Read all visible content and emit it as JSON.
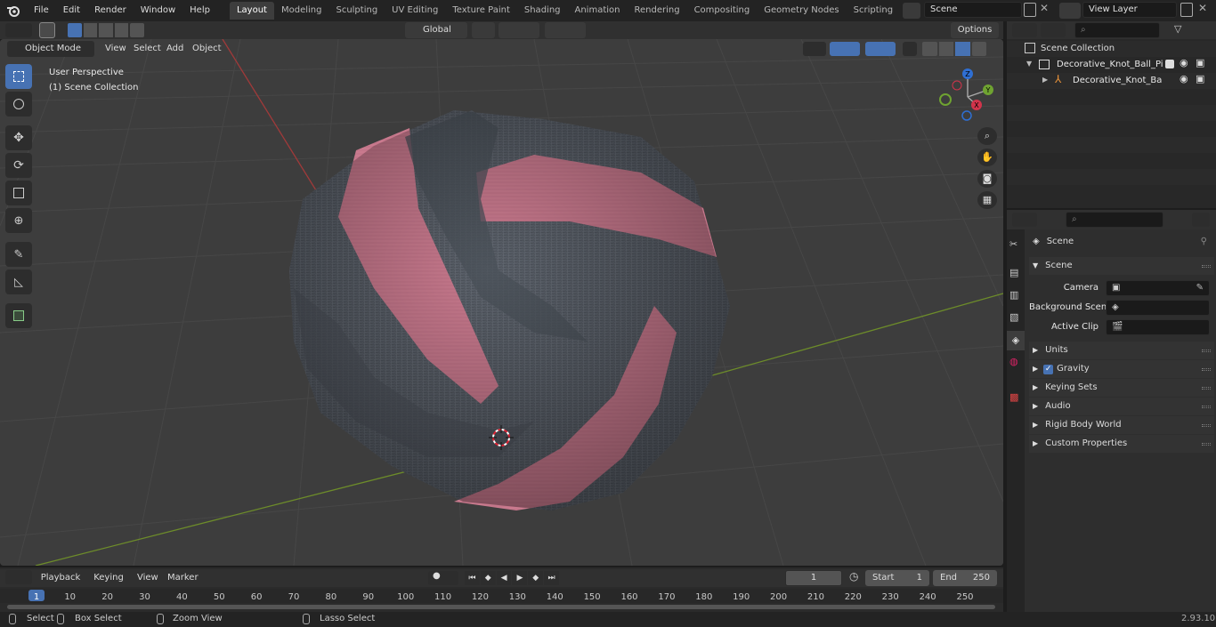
{
  "menus": [
    "File",
    "Edit",
    "Render",
    "Window",
    "Help"
  ],
  "workspaces": [
    "Layout",
    "Modeling",
    "Sculpting",
    "UV Editing",
    "Texture Paint",
    "Shading",
    "Animation",
    "Rendering",
    "Compositing",
    "Geometry Nodes",
    "Scripting"
  ],
  "active_workspace": "Layout",
  "scene_field": "Scene",
  "view_layer_field": "View Layer",
  "viewport_header": {
    "mode": "Object Mode",
    "view": "View",
    "select": "Select",
    "add": "Add",
    "object": "Object",
    "orientation": "Global",
    "options": "Options"
  },
  "viewport_overlay": {
    "perspective": "User Perspective",
    "collection": "(1) Scene Collection"
  },
  "gizmo": {
    "x": "X",
    "y": "Y",
    "z": "Z"
  },
  "outliner": {
    "root": "Scene Collection",
    "item1": "Decorative_Knot_Ball_Pillow_(",
    "item2": "Decorative_Knot_Ball_Pill"
  },
  "properties": {
    "scene_name": "Scene",
    "section": "Scene",
    "camera_label": "Camera",
    "background_label": "Background Scene",
    "clip_label": "Active Clip",
    "panels": [
      "Units",
      "Gravity",
      "Keying Sets",
      "Audio",
      "Rigid Body World",
      "Custom Properties"
    ]
  },
  "timeline": {
    "playback": "Playback",
    "keying": "Keying",
    "view": "View",
    "marker": "Marker",
    "current": "1",
    "start_label": "Start",
    "start": "1",
    "end_label": "End",
    "end": "250",
    "ticks": [
      "1",
      "10",
      "20",
      "30",
      "40",
      "50",
      "60",
      "70",
      "80",
      "90",
      "100",
      "110",
      "120",
      "130",
      "140",
      "150",
      "160",
      "170",
      "180",
      "190",
      "200",
      "210",
      "220",
      "230",
      "240",
      "250"
    ]
  },
  "statusbar": {
    "select": "Select",
    "box_select": "Box Select",
    "zoom_view": "Zoom View",
    "lasso_select": "Lasso Select",
    "version": "2.93.10"
  },
  "colors": {
    "accent": "#4772b3",
    "pink": "#c97a8e",
    "fabric": "#585f69"
  }
}
